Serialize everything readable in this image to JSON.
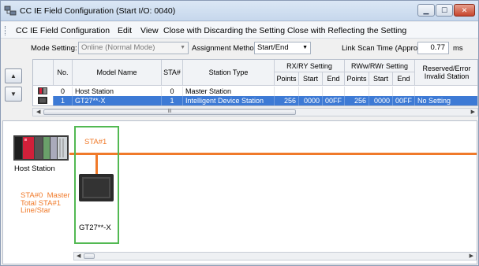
{
  "window": {
    "title": "CC IE Field Configuration (Start I/O: 0040)"
  },
  "menu": {
    "items": [
      "CC IE Field Configuration",
      "Edit",
      "View",
      "Close with Discarding the Setting",
      "Close with Reflecting the Setting"
    ]
  },
  "settings": {
    "mode_label": "Mode Setting:",
    "mode_value": "Online (Normal Mode)",
    "assignment_label": "Assignment Method:",
    "assignment_value": "Start/End",
    "link_scan_label": "Link Scan Time (Approx.):",
    "link_scan_value": "0.77",
    "link_scan_unit": "ms"
  },
  "table": {
    "headers": {
      "no": "No.",
      "model": "Model Name",
      "sta": "STA#",
      "station_type": "Station Type",
      "rxry": "RX/RY Setting",
      "rwwrwr": "RWw/RWr Setting",
      "reserved": "Reserved/Error Invalid Station",
      "points": "Points",
      "start": "Start",
      "end": "End"
    },
    "rows": [
      {
        "no": "0",
        "model": "Host Station",
        "sta": "0",
        "station_type": "Master Station",
        "rx_points": "",
        "rx_start": "",
        "rx_end": "",
        "rw_points": "",
        "rw_start": "",
        "rw_end": "",
        "reserved": ""
      },
      {
        "no": "1",
        "model": "GT27**-X",
        "sta": "1",
        "station_type": "Intelligent Device Station",
        "rx_points": "256",
        "rx_start": "0000",
        "rx_end": "00FF",
        "rw_points": "256",
        "rw_start": "0000",
        "rw_end": "00FF",
        "reserved": "No Setting"
      }
    ],
    "scroll_thumb": "III"
  },
  "diagram": {
    "host_label": "Host Station",
    "info_text": "STA#0  Master\nTotal STA#1\nLine/Star",
    "sta_label": "STA#1",
    "device_label": "GT27**-X"
  },
  "colors": {
    "accent_orange": "#f07a2a",
    "selection_blue": "#3d7ad5",
    "sta_box_green": "#52b952"
  }
}
